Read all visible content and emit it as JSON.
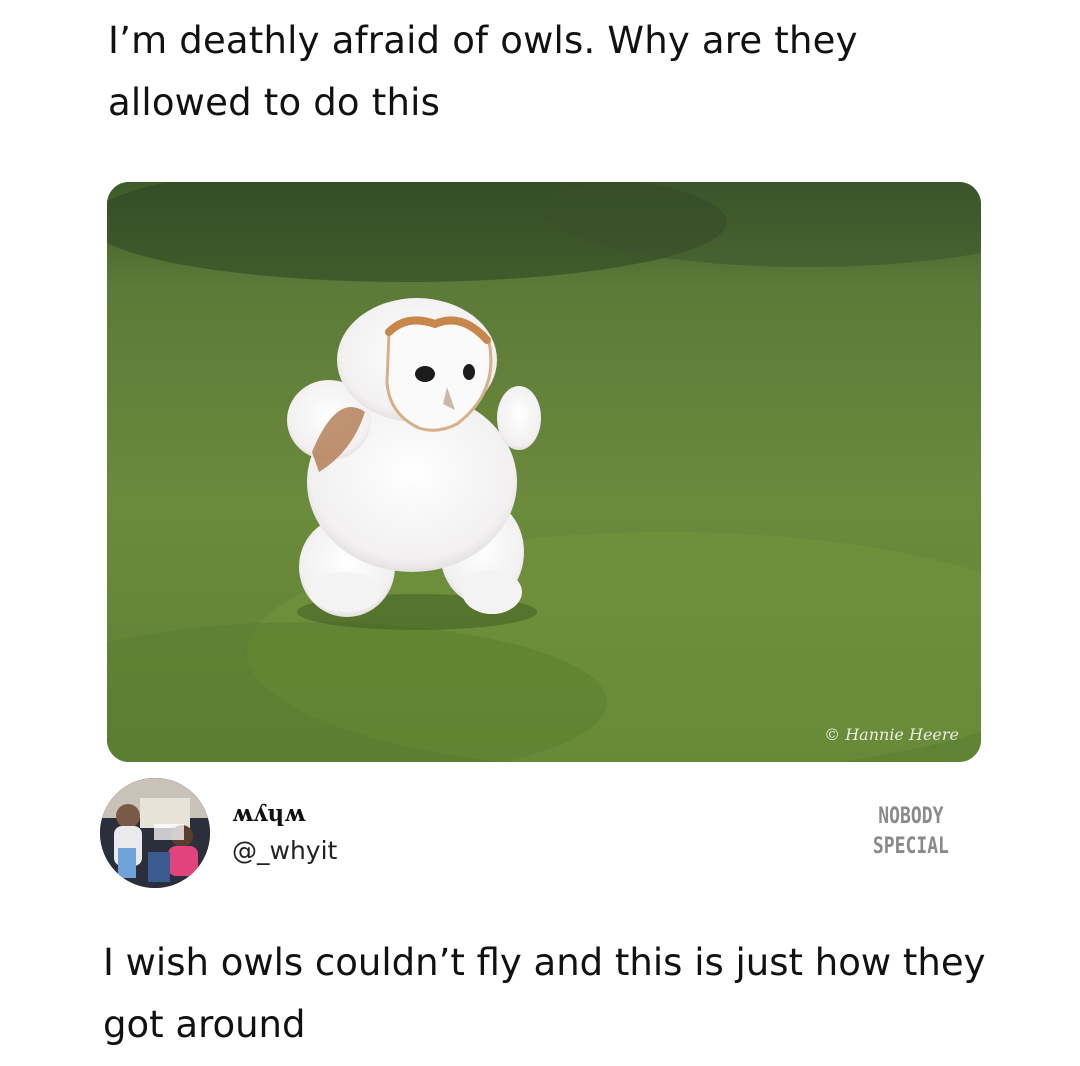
{
  "top_tweet": {
    "text": "I’m deathly afraid of owls. Why are they allowed to do this"
  },
  "photo": {
    "credit": "© Hannie Heere",
    "subject_icon": "owl-photo"
  },
  "author": {
    "display_name": "ʍʎɥʍ",
    "handle": "@_whyit",
    "avatar_icon": "avatar-photo"
  },
  "watermark": {
    "line1": "NOBODY",
    "line2": "SPECIAL"
  },
  "reply": {
    "text": "I wish owls couldn’t fly and this is just how they got around"
  },
  "colors": {
    "background": "#ffffff",
    "text": "#111111",
    "grass": "#5d7a34",
    "watermark": "#8a8a8a"
  }
}
